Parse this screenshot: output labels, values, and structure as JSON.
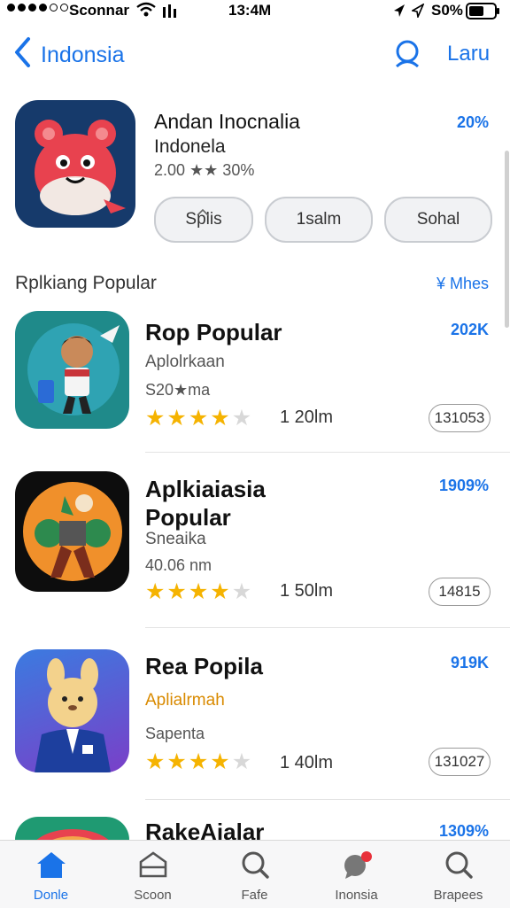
{
  "status_bar": {
    "carrier": "Sconnar",
    "time": "13:4M",
    "battery": "S0%"
  },
  "nav": {
    "back_label": "Indonsia",
    "right_label": "Laru"
  },
  "featured": {
    "title": "Andan Inocnalia",
    "subtitle": "Indonela",
    "rating_text": "2.00 ★★ 30%",
    "percent": "20%",
    "buttons": [
      "Splis",
      "1salm",
      "Sohal"
    ]
  },
  "section": {
    "title": "Rplkiang Popular",
    "more_label": "¥ Mhes"
  },
  "apps": [
    {
      "name": "Rop Popular",
      "category": "Aplolrkaan",
      "meta": "S20★ma",
      "stars": 4.5,
      "count": "1 20lm",
      "percent": "202K",
      "rank": "131053",
      "rank_top": ""
    },
    {
      "name": "Aplkiaiasia Popular",
      "category": "Sneaika",
      "meta": "40.06 nm",
      "stars": 4.5,
      "count": "1 50lm",
      "percent": "1909%",
      "rank": "14815",
      "rank_top": ""
    },
    {
      "name": "Rea Popila",
      "category": "Aplialrmah",
      "meta": "Sapenta",
      "stars": 4.5,
      "count": "1 40lm",
      "percent": "919K",
      "rank": "131027",
      "rank_top": ""
    },
    {
      "name": "RakeAialar",
      "percent": "1309%"
    }
  ],
  "tabs": [
    "Donle",
    "Scoon",
    "Fafe",
    "Inonsia",
    "Brapees"
  ],
  "colors": {
    "accent": "#1a73e8",
    "star": "#f5b301",
    "category_orange": "#d98a00"
  }
}
